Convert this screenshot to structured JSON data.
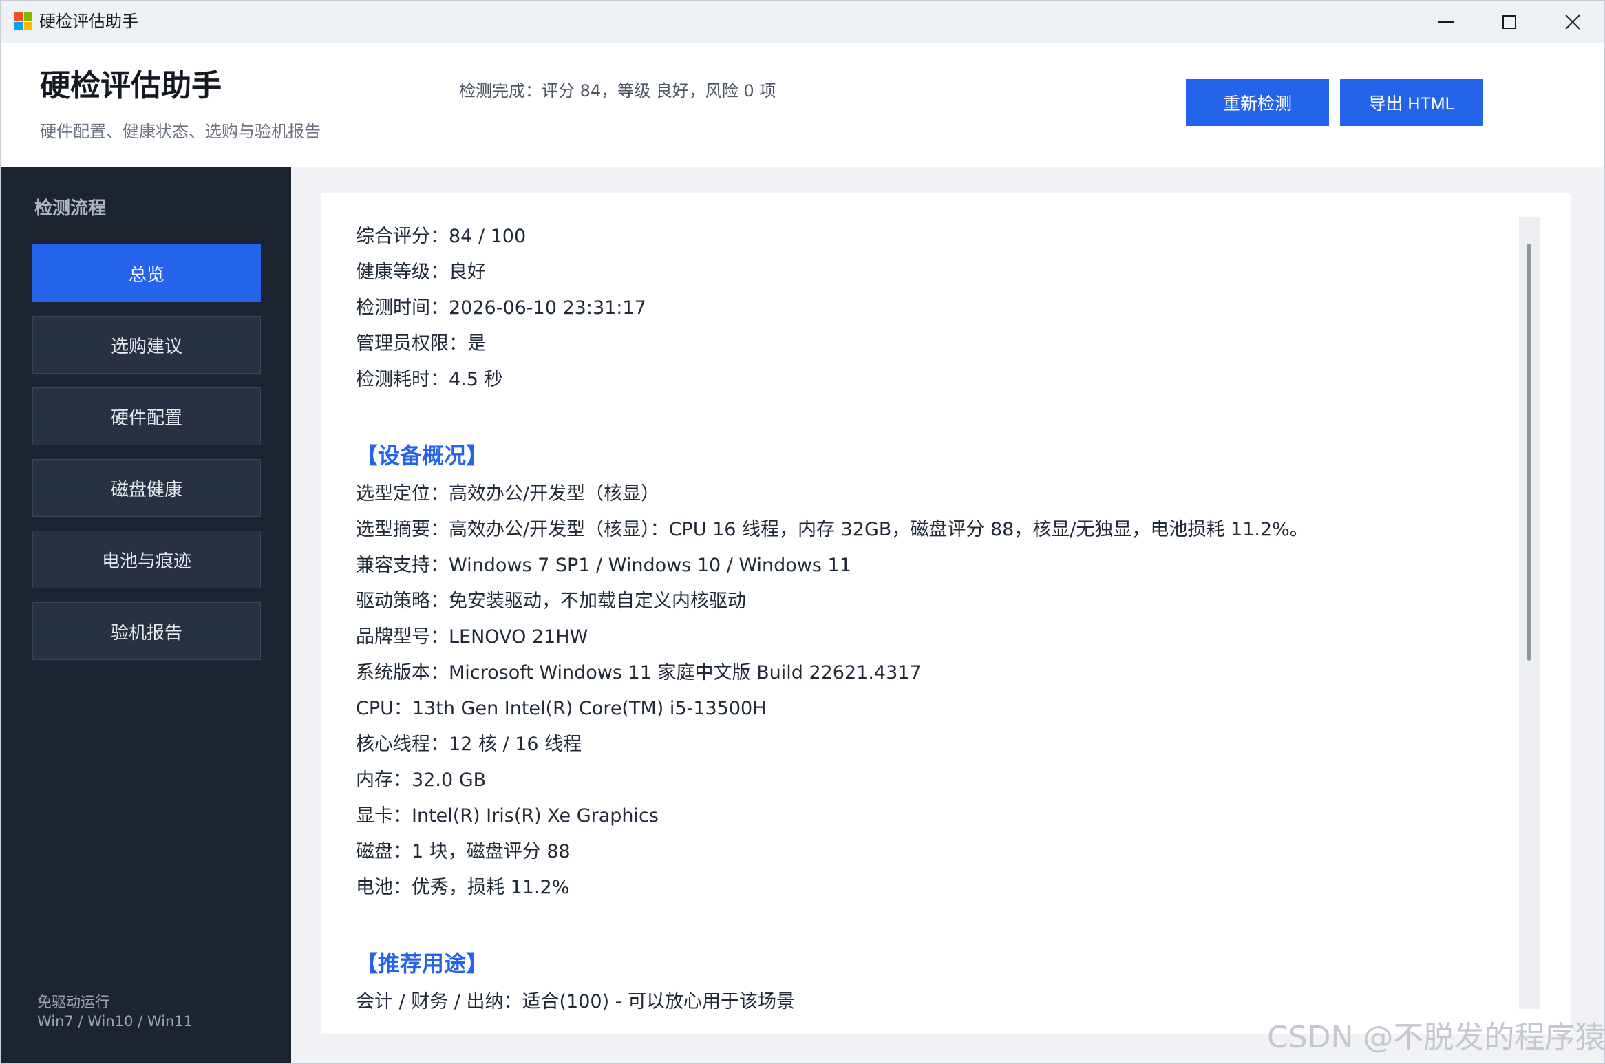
{
  "window": {
    "title": "硬检评估助手"
  },
  "header": {
    "title": "硬检评估助手",
    "subtitle": "硬件配置、健康状态、选购与验机报告",
    "status": "检测完成：评分 84，等级 良好，风险 0 项",
    "rescan_label": "重新检测",
    "export_label": "导出 HTML",
    "accent_color": "#2563eb"
  },
  "sidebar": {
    "heading": "检测流程",
    "items": [
      {
        "label": "总览",
        "active": true
      },
      {
        "label": "选购建议",
        "active": false
      },
      {
        "label": "硬件配置",
        "active": false
      },
      {
        "label": "磁盘健康",
        "active": false
      },
      {
        "label": "电池与痕迹",
        "active": false
      },
      {
        "label": "验机报告",
        "active": false
      }
    ],
    "footer_line1": "免驱动运行",
    "footer_line2": "Win7 / Win10 / Win11"
  },
  "report": {
    "summary": [
      "综合评分：84 / 100",
      "健康等级：良好",
      "检测时间：2026-06-10 23:31:17",
      "管理员权限：是",
      "检测耗时：4.5 秒"
    ],
    "device_section_title": "【设备概况】",
    "device_lines": [
      "选型定位：高效办公/开发型（核显）",
      "选型摘要：高效办公/开发型（核显）：CPU 16 线程，内存 32GB，磁盘评分 88，核显/无独显，电池损耗 11.2%。",
      "兼容支持：Windows 7 SP1 / Windows 10 / Windows 11",
      "驱动策略：免安装驱动，不加载自定义内核驱动",
      "品牌型号：LENOVO 21HW",
      "系统版本：Microsoft Windows 11 家庭中文版 Build 22621.4317",
      "CPU：13th Gen Intel(R) Core(TM) i5-13500H",
      "核心线程：12 核 / 16 线程",
      "内存：32.0 GB",
      "显卡：Intel(R) Iris(R) Xe Graphics",
      "磁盘：1 块，磁盘评分 88",
      "电池：优秀，损耗 11.2%"
    ],
    "usage_section_title": "【推荐用途】",
    "usage_lines": [
      "会计 / 财务 / 出纳：适合(100) - 可以放心用于该场景"
    ]
  },
  "watermark": "CSDN @不脱发的程序猿"
}
